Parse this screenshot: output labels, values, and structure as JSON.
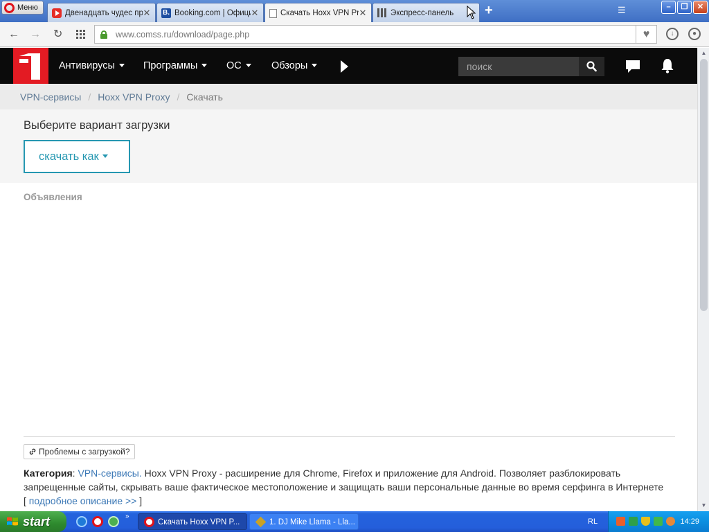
{
  "browser": {
    "menu_label": "Меню",
    "tabs": [
      {
        "title": "Двенадцать чудес природы",
        "favicon": "youtube-icon"
      },
      {
        "title": "Booking.com | Официальный сайт",
        "favicon": "booking-icon"
      },
      {
        "title": "Скачать Hoxx VPN Proxy",
        "favicon": "page-icon"
      },
      {
        "title": "Экспресс-панель",
        "favicon": "speed-dial-icon"
      }
    ],
    "active_tab": 2,
    "address": "www.comss.ru/download/page.php"
  },
  "site": {
    "logo_text": "1",
    "nav": [
      {
        "label": "Антивирусы"
      },
      {
        "label": "Программы"
      },
      {
        "label": "ОС"
      },
      {
        "label": "Обзоры"
      }
    ],
    "search_placeholder": "поиск"
  },
  "breadcrumb": {
    "items": [
      "VPN-сервисы",
      "Hoxx VPN Proxy"
    ],
    "current": "Скачать"
  },
  "download": {
    "title": "Выберите вариант загрузки",
    "button_label": "скачать как"
  },
  "ads": {
    "label": "Объявления"
  },
  "problems_button": "Проблемы с загрузкой?",
  "description": {
    "category_label": "Категория",
    "category_link": "VPN-сервисы.",
    "text": " Hoxx VPN Proxy - расширение для Chrome, Firefox и приложение для Android. Позволяет разблокировать запрещенные сайты, скрывать ваше фактическое местоположение и защищать ваши персональные данные во время серфинга в Интернете",
    "more_open": "[ ",
    "more_link": "подробное описание >>",
    "more_close": " ]"
  },
  "taskbar": {
    "start_label": "start",
    "tasks": [
      {
        "label": "Скачать Hoxx VPN P...",
        "icon": "opera-icon",
        "active": true
      },
      {
        "label": "1. DJ Mike Llama - Lla...",
        "icon": "winamp-icon",
        "active": false
      }
    ],
    "language": "RL",
    "clock": "14:29"
  },
  "colors": {
    "brand_red": "#e31b23",
    "header_bg": "#0b0b0b",
    "accent_teal": "#2597b1",
    "link_blue": "#3a77b5"
  }
}
